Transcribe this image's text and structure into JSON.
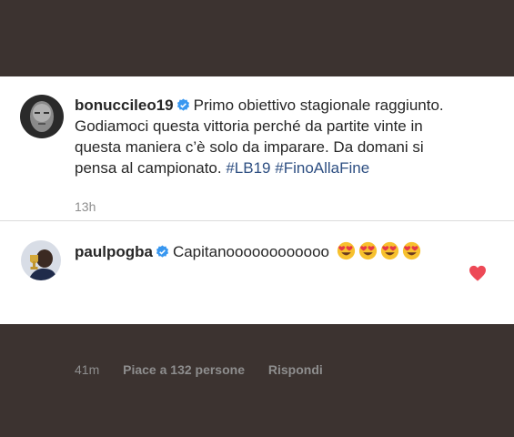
{
  "comments": [
    {
      "username": "bonuccileo19",
      "text": "Primo obiettivo stagionale raggiunto. Godiamoci questa vittoria perché da partite vinte in questa maniera c’è solo da imparare. Da domani si pensa al campionato.",
      "hashtags": [
        "#LB19",
        "#FinoAllaFine"
      ],
      "time": "13h",
      "avatar_icon": "profile-photo-bonucci",
      "verified_icon": "verified-badge-icon"
    },
    {
      "username": "paulpogba",
      "text": "Capitanoooooooooooo",
      "emoji_icon": "heart-eyes-emoji",
      "emoji_count": 4,
      "time": "41m",
      "likes": "Piace a 132 persone",
      "reply": "Rispondi",
      "avatar_icon": "profile-photo-pogba",
      "verified_icon": "verified-badge-icon",
      "liked_icon": "heart-filled-icon"
    }
  ],
  "colors": {
    "background": "#3c3330",
    "panel": "#ffffff",
    "hashtag": "#2e4f82",
    "verified": "#3897f0",
    "heart": "#ed4956",
    "meta": "#8e8e8e"
  }
}
